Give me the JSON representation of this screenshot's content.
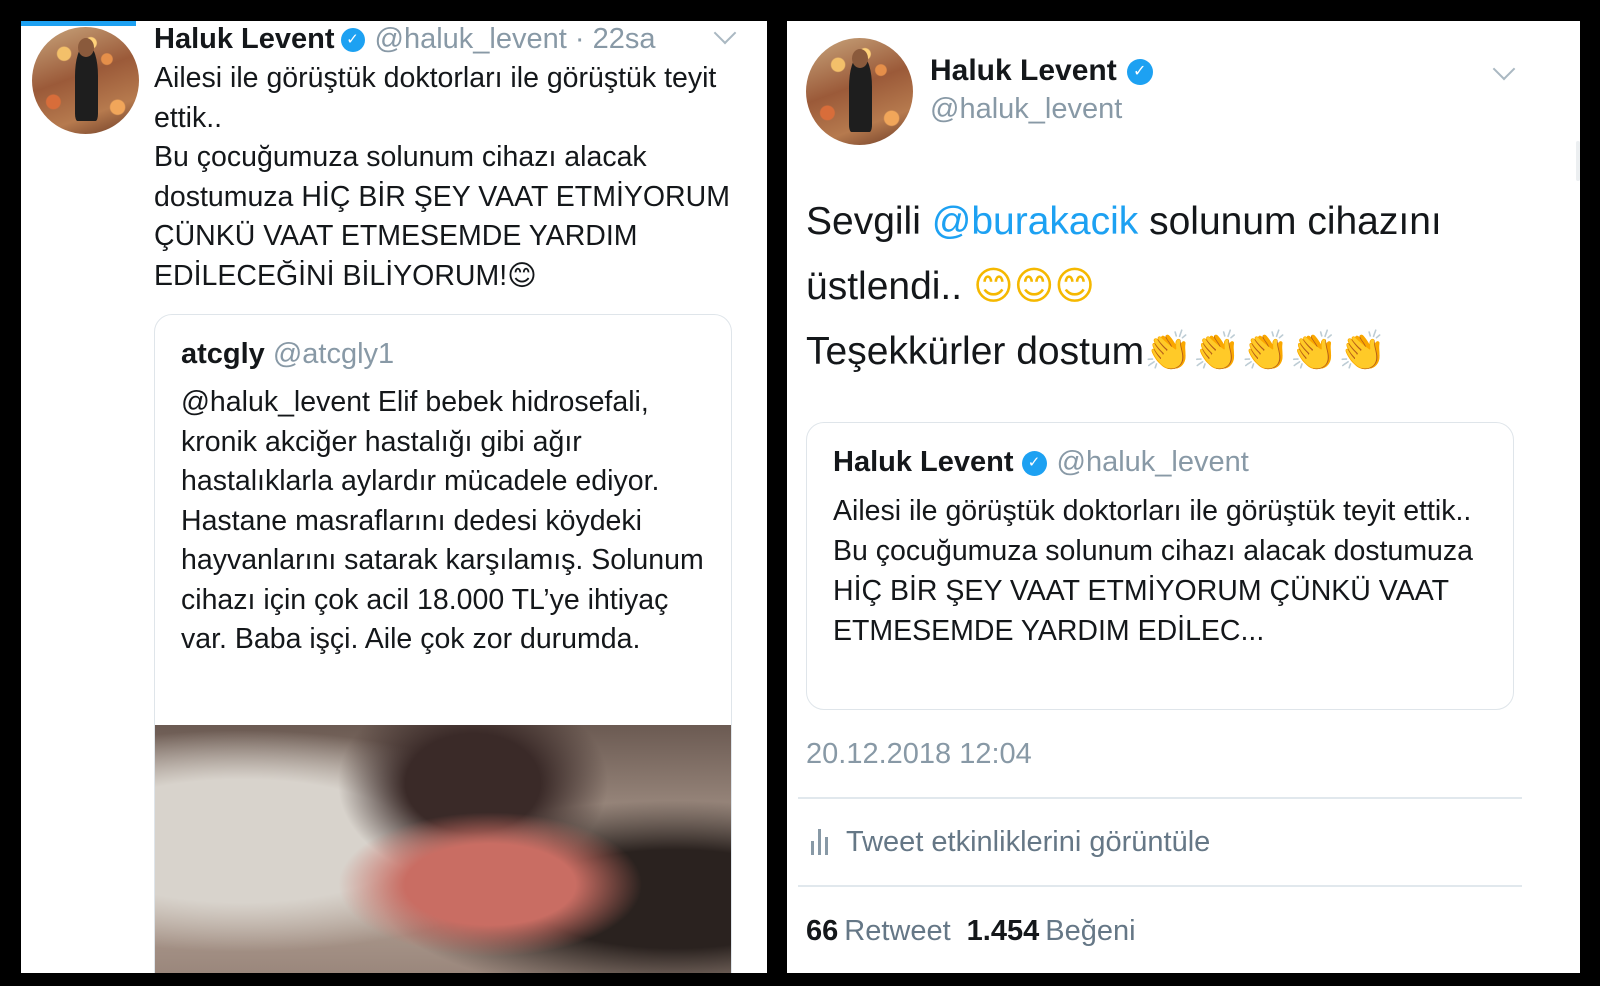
{
  "left_tweet": {
    "author_name": "Haluk Levent",
    "handle": "@haluk_levent",
    "separator": "·",
    "time": "22sa",
    "text": "Ailesi ile görüştük doktorları ile görüştük teyit ettik..\nBu çocuğumuza solunum cihazı alacak dostumuza HİÇ BİR ŞEY VAAT ETMİYORUM ÇÜNKÜ VAAT ETMESEMDE YARDIM EDİLECEĞİNİ BİLİYORUM!😊",
    "quoted": {
      "author_name": "atcgly",
      "handle": "@atcgly1",
      "text": "@haluk_levent  Elif bebek hidrosefali, kronik akciğer hastalığı gibi ağır hastalıklarla aylardır mücadele ediyor. Hastane masraflarını dedesi köydeki hayvanlarını satarak karşılamış. Solunum cihazı için çok acil 18.000 TL’ye ihtiyaç var. Baba işçi. Aile çok zor durumda."
    }
  },
  "right_tweet": {
    "author_name": "Haluk Levent",
    "handle": "@haluk_levent",
    "text_prefix": "Sevgili ",
    "mention": "@burakacik",
    "text_suffix": " solunum cihazını üstlendi.. ",
    "emojis_smile": "😊😊😊",
    "text_line3": "Teşekkürler dostum",
    "emojis_clap": "👏👏👏👏👏",
    "quoted": {
      "author_name": "Haluk Levent",
      "handle": "@haluk_levent",
      "text": "Ailesi ile görüştük doktorları ile görüştük teyit ettik..\nBu çocuğumuza solunum cihazı alacak dostumuza HİÇ BİR ŞEY VAAT ETMİYORUM ÇÜNKÜ VAAT ETMESEMDE YARDIM EDİLEC..."
    },
    "date": "20.12.2018 12:04",
    "activity_label": "Tweet etkinliklerini görüntüle",
    "retweet_count": "66",
    "retweet_label": "Retweet",
    "like_count": "1.454",
    "like_label": "Beğeni"
  },
  "colors": {
    "accent": "#1da1f2",
    "secondary_text": "#8899a6",
    "border": "#dfe5ea"
  },
  "icons": {
    "verified": "verified-badge-icon",
    "chevron": "chevron-down-icon",
    "stats": "bar-chart-icon"
  }
}
